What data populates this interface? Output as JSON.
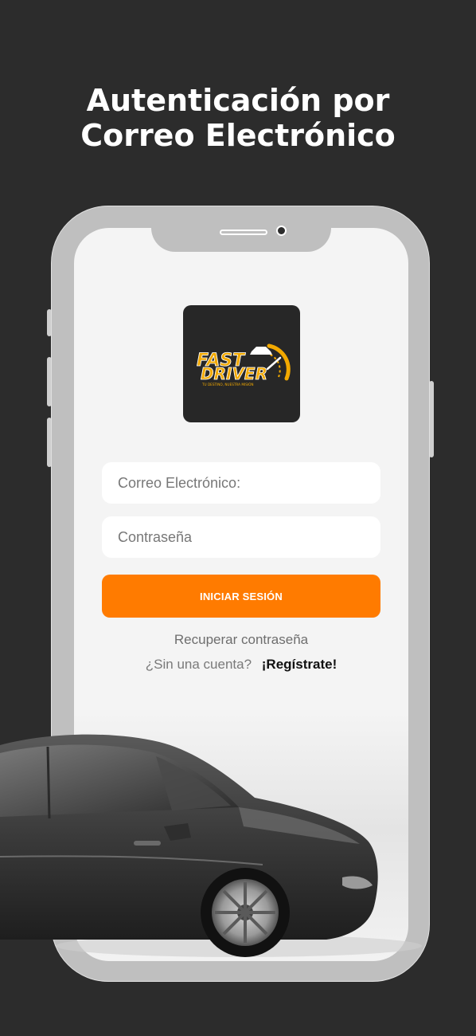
{
  "headline": {
    "line1": "Autenticación por",
    "line2": "Correo Electrónico"
  },
  "logo": {
    "word1": "FAST",
    "word2": "DRIVER",
    "tagline": "TU DESTINO, NUESTRA MISIÓN",
    "accent_color": "#f2a900"
  },
  "form": {
    "email_placeholder": "Correo Electrónico:",
    "password_placeholder": "Contraseña",
    "login_label": "INICIAR SESIÓN",
    "recover_label": "Recuperar contraseña",
    "signup_prompt": "¿Sin una cuenta?",
    "signup_label": "¡Regístrate!"
  },
  "colors": {
    "background": "#2c2c2c",
    "primary": "#ff7b00",
    "screen": "#f4f4f4"
  }
}
